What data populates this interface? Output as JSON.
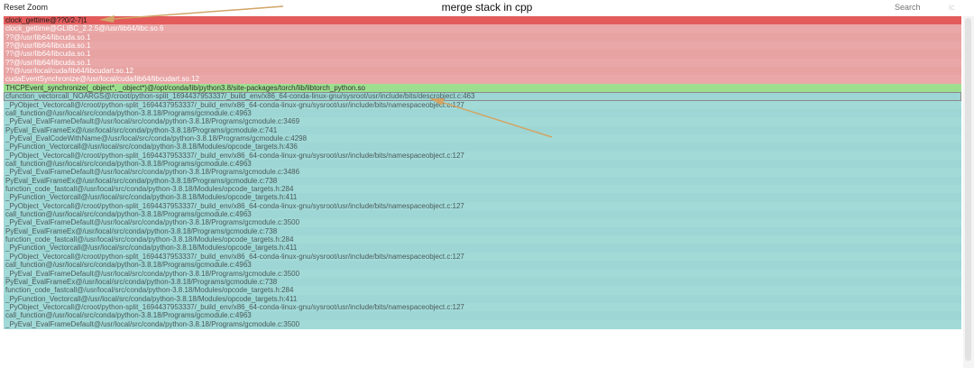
{
  "toolbar": {
    "reset_zoom_label": "Reset Zoom",
    "title": "merge stack in cpp",
    "search_placeholder": "Search",
    "clear_label": "ic"
  },
  "colors": {
    "top_frame": "#e35b5b",
    "native_frame": "#eaa7a7",
    "native_frame_alt": "#e7a2a2",
    "torch_frame": "#9ddf8f",
    "python_frame": "#9dd6d4",
    "python_frame_alt": "#a2dad8",
    "arrow": "#d1a566"
  },
  "chart_data": {
    "type": "flamegraph",
    "title": "merge stack in cpp",
    "orientation": "icicle",
    "frames": [
      {
        "label": "clock_gettime@??0/2-7|1",
        "kind": "top"
      },
      {
        "label": "clock_gettime@GLIBC_2.2.5@/usr/lib64/libc.so.6",
        "kind": "native"
      },
      {
        "label": "??@/usr/lib64/libcuda.so.1",
        "kind": "native"
      },
      {
        "label": "??@/usr/lib64/libcuda.so.1",
        "kind": "native"
      },
      {
        "label": "??@/usr/lib64/libcuda.so.1",
        "kind": "native"
      },
      {
        "label": "??@/usr/lib64/libcuda.so.1",
        "kind": "native"
      },
      {
        "label": "??@/usr/local/cuda/lib64/libcudart.so.12",
        "kind": "native"
      },
      {
        "label": "cudaEventSynchronize@/usr/local/cuda/lib64/libcudart.so.12",
        "kind": "native"
      },
      {
        "label": "THCPEvent_synchronize(_object*, _object*)@/opt/conda/lib/python3.8/site-packages/torch/lib/libtorch_python.so",
        "kind": "torch"
      },
      {
        "label": "cfunction_vectorcall_NOARGS@/croot/python-split_1694437953337/_build_env/x86_64-conda-linux-gnu/sysroot/usr/include/bits/descrobject.c:463",
        "kind": "python",
        "highlighted": true
      },
      {
        "label": "_PyObject_Vectorcall@/croot/python-split_1694437953337/_build_env/x86_64-conda-linux-gnu/sysroot/usr/include/bits/namespaceobject.c:127",
        "kind": "python"
      },
      {
        "label": "call_function@/usr/local/src/conda/python-3.8.18/Programs/gcmodule.c:4963",
        "kind": "python"
      },
      {
        "label": "_PyEval_EvalFrameDefault@/usr/local/src/conda/python-3.8.18/Programs/gcmodule.c:3469",
        "kind": "python"
      },
      {
        "label": "PyEval_EvalFrameEx@/usr/local/src/conda/python-3.8.18/Programs/gcmodule.c:741",
        "kind": "python"
      },
      {
        "label": "_PyEval_EvalCodeWithName@/usr/local/src/conda/python-3.8.18/Programs/gcmodule.c:4298",
        "kind": "python"
      },
      {
        "label": "_PyFunction_Vectorcall@/usr/local/src/conda/python-3.8.18/Modules/opcode_targets.h:436",
        "kind": "python"
      },
      {
        "label": "_PyObject_Vectorcall@/croot/python-split_1694437953337/_build_env/x86_64-conda-linux-gnu/sysroot/usr/include/bits/namespaceobject.c:127",
        "kind": "python"
      },
      {
        "label": "call_function@/usr/local/src/conda/python-3.8.18/Programs/gcmodule.c:4963",
        "kind": "python"
      },
      {
        "label": "_PyEval_EvalFrameDefault@/usr/local/src/conda/python-3.8.18/Programs/gcmodule.c:3486",
        "kind": "python"
      },
      {
        "label": "PyEval_EvalFrameEx@/usr/local/src/conda/python-3.8.18/Programs/gcmodule.c:738",
        "kind": "python"
      },
      {
        "label": "function_code_fastcall@/usr/local/src/conda/python-3.8.18/Modules/opcode_targets.h:284",
        "kind": "python"
      },
      {
        "label": "_PyFunction_Vectorcall@/usr/local/src/conda/python-3.8.18/Modules/opcode_targets.h:411",
        "kind": "python"
      },
      {
        "label": "_PyObject_Vectorcall@/croot/python-split_1694437953337/_build_env/x86_64-conda-linux-gnu/sysroot/usr/include/bits/namespaceobject.c:127",
        "kind": "python"
      },
      {
        "label": "call_function@/usr/local/src/conda/python-3.8.18/Programs/gcmodule.c:4963",
        "kind": "python"
      },
      {
        "label": "_PyEval_EvalFrameDefault@/usr/local/src/conda/python-3.8.18/Programs/gcmodule.c:3500",
        "kind": "python"
      },
      {
        "label": "PyEval_EvalFrameEx@/usr/local/src/conda/python-3.8.18/Programs/gcmodule.c:738",
        "kind": "python"
      },
      {
        "label": "function_code_fastcall@/usr/local/src/conda/python-3.8.18/Modules/opcode_targets.h:284",
        "kind": "python"
      },
      {
        "label": "_PyFunction_Vectorcall@/usr/local/src/conda/python-3.8.18/Modules/opcode_targets.h:411",
        "kind": "python"
      },
      {
        "label": "_PyObject_Vectorcall@/croot/python-split_1694437953337/_build_env/x86_64-conda-linux-gnu/sysroot/usr/include/bits/namespaceobject.c:127",
        "kind": "python"
      },
      {
        "label": "call_function@/usr/local/src/conda/python-3.8.18/Programs/gcmodule.c:4963",
        "kind": "python"
      },
      {
        "label": "_PyEval_EvalFrameDefault@/usr/local/src/conda/python-3.8.18/Programs/gcmodule.c:3500",
        "kind": "python"
      },
      {
        "label": "PyEval_EvalFrameEx@/usr/local/src/conda/python-3.8.18/Programs/gcmodule.c:738",
        "kind": "python"
      },
      {
        "label": "function_code_fastcall@/usr/local/src/conda/python-3.8.18/Modules/opcode_targets.h:284",
        "kind": "python"
      },
      {
        "label": "_PyFunction_Vectorcall@/usr/local/src/conda/python-3.8.18/Modules/opcode_targets.h:411",
        "kind": "python"
      },
      {
        "label": "_PyObject_Vectorcall@/croot/python-split_1694437953337/_build_env/x86_64-conda-linux-gnu/sysroot/usr/include/bits/namespaceobject.c:127",
        "kind": "python"
      },
      {
        "label": "call_function@/usr/local/src/conda/python-3.8.18/Programs/gcmodule.c:4963",
        "kind": "python"
      },
      {
        "label": "_PyEval_EvalFrameDefault@/usr/local/src/conda/python-3.8.18/Programs/gcmodule.c:3500",
        "kind": "python"
      }
    ]
  }
}
